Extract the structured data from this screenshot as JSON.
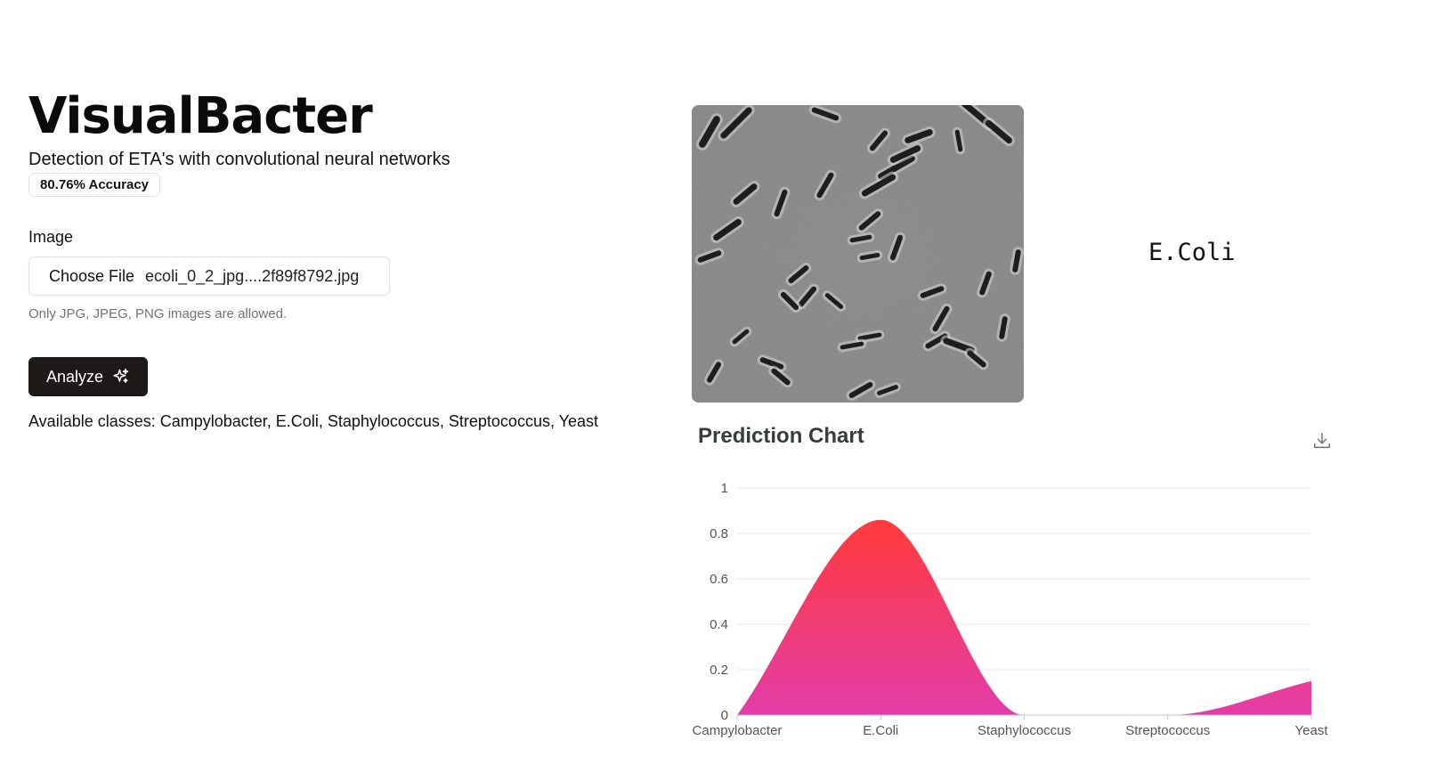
{
  "app": {
    "title": "VisualBacter",
    "subtitle": "Detection of ETA's with convolutional neural networks",
    "accuracy_badge": "80.76% Accuracy"
  },
  "form": {
    "image_label": "Image",
    "choose_file_label": "Choose File",
    "file_name": "ecoli_0_2_jpg....2f89f8792.jpg",
    "hint": "Only JPG, JPEG, PNG images are allowed.",
    "analyze_label": "Analyze",
    "available_classes": "Available classes: Campylobacter, E.Coli, Staphylococcus, Streptococcus, Yeast"
  },
  "result": {
    "prediction": "E.Coli"
  },
  "icons": {
    "analyze": "sparkles-icon",
    "download": "download-icon"
  },
  "chart_data": {
    "type": "area",
    "title": "Prediction Chart",
    "categories": [
      "Campylobacter",
      "E.Coli",
      "Staphylococcus",
      "Streptococcus",
      "Yeast"
    ],
    "values": [
      0.0,
      0.86,
      0.0,
      0.0,
      0.15
    ],
    "ylim": [
      0,
      1
    ],
    "yticks": [
      "0",
      "0.2",
      "0.4",
      "0.6",
      "0.8",
      "1"
    ],
    "smooth": true,
    "grid": true,
    "colors": {
      "top": "#ff3b3b",
      "bottom": "#e33ca8"
    }
  }
}
